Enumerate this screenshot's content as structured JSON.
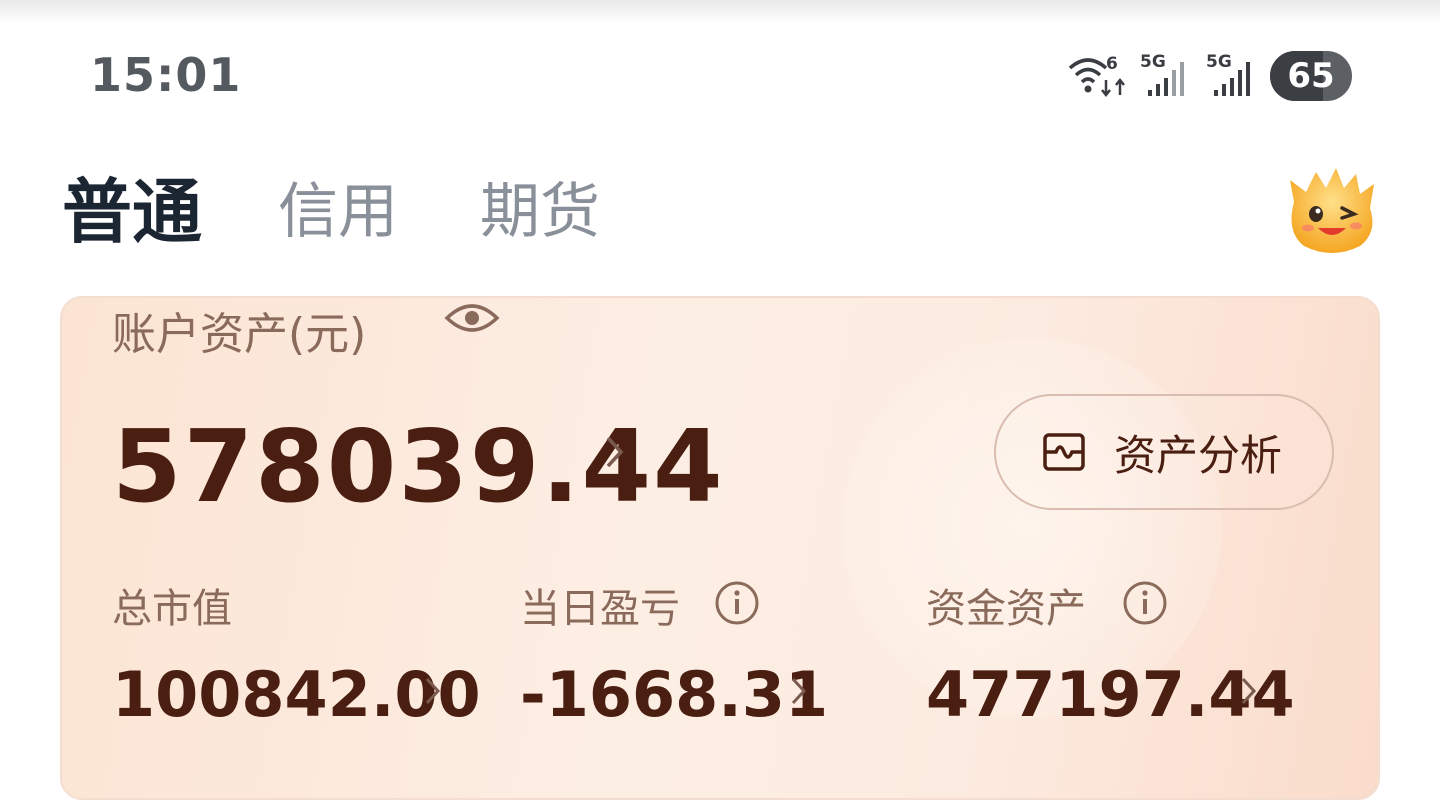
{
  "status_bar": {
    "time": "15:01",
    "wifi_label": "6",
    "signal1_label": "5G",
    "signal2_label": "5G",
    "battery_percent": "65",
    "battery_level": 0.65
  },
  "tabs": [
    {
      "label": "普通",
      "active": true
    },
    {
      "label": "信用",
      "active": false
    },
    {
      "label": "期货",
      "active": false
    }
  ],
  "account": {
    "title": "账户资产(元)",
    "total": "578039.44",
    "analysis_label": "资产分析"
  },
  "stats": [
    {
      "label": "总市值",
      "value": "100842.00",
      "has_info": false
    },
    {
      "label": "当日盈亏",
      "value": "-1668.31",
      "has_info": true
    },
    {
      "label": "资金资产",
      "value": "477197.44",
      "has_info": true
    }
  ],
  "colors": {
    "accent_text": "#4a1e10",
    "muted_text": "#8a6a5a",
    "card_bg": "#fbe4d3"
  },
  "icons": [
    "wifi-icon",
    "signal-icon",
    "battery-icon",
    "mascot-icon",
    "eye-icon",
    "chevron-right-icon",
    "analysis-icon",
    "info-icon"
  ]
}
